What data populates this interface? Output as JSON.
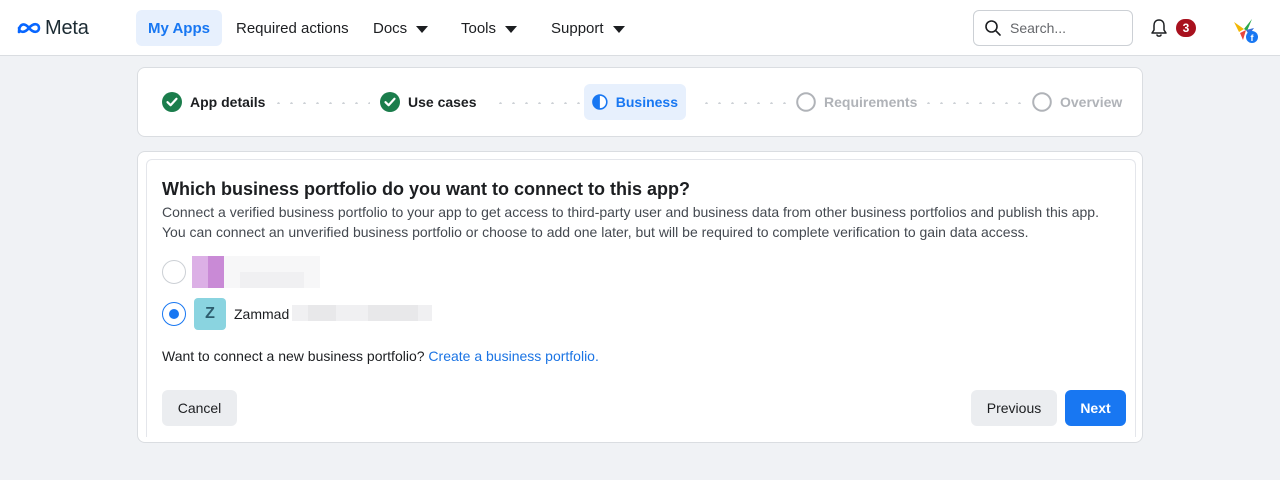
{
  "nav": {
    "logo_text": "Meta",
    "items": [
      {
        "label": "My Apps"
      },
      {
        "label": "Required actions"
      },
      {
        "label": "Docs"
      },
      {
        "label": "Tools"
      },
      {
        "label": "Support"
      }
    ],
    "search_placeholder": "Search...",
    "notification_count": "3"
  },
  "stepper": {
    "steps": [
      {
        "label": "App details",
        "status": "complete"
      },
      {
        "label": "Use cases",
        "status": "complete"
      },
      {
        "label": "Business",
        "status": "current"
      },
      {
        "label": "Requirements",
        "status": "pending"
      },
      {
        "label": "Overview",
        "status": "pending"
      }
    ]
  },
  "content": {
    "title": "Which business portfolio do you want to connect to this app?",
    "description": "Connect a verified business portfolio to your app to get access to third-party user and business data from other business portfolios and publish this app. You can connect an unverified business portfolio or choose to add one later, but will be required to complete verification to gain data access.",
    "portfolios": [
      {
        "name": "",
        "selected": false
      },
      {
        "name": "Zammad",
        "avatar_letter": "Z",
        "selected": true
      }
    ],
    "connect_prompt": "Want to connect a new business portfolio?",
    "connect_link": "Create a business portfolio."
  },
  "buttons": {
    "cancel": "Cancel",
    "previous": "Previous",
    "next": "Next"
  },
  "colors": {
    "primary": "#1877f2",
    "complete": "#1b7d4c",
    "badge": "#a8111e"
  }
}
